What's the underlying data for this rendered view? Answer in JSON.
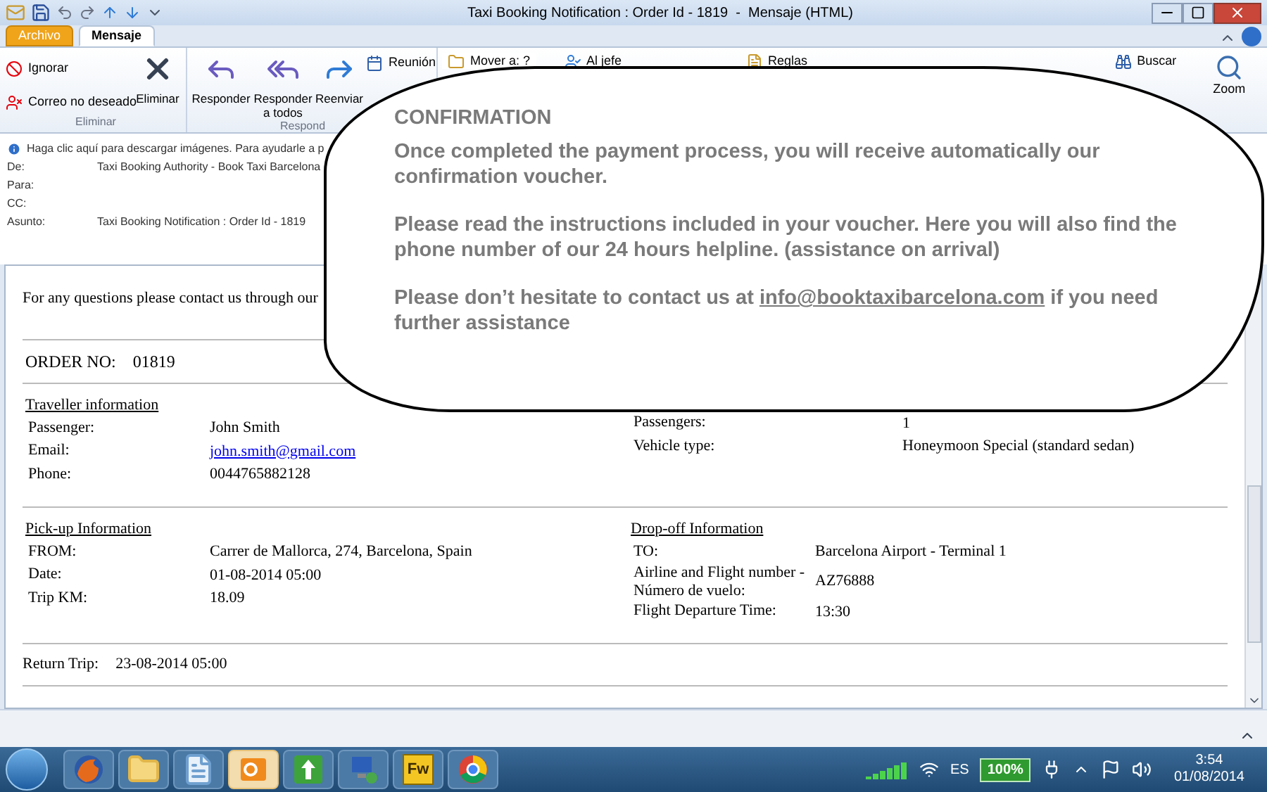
{
  "window": {
    "title": "Taxi Booking Notification : Order Id - 1819  -  Mensaje (HTML)"
  },
  "tabs": [
    {
      "label": "Archivo",
      "kind": "file",
      "selected": false
    },
    {
      "label": "Mensaje",
      "kind": "tab",
      "selected": true
    }
  ],
  "ribbon": {
    "groups": [
      {
        "label": "Eliminar",
        "small_buttons": [
          {
            "label": "Ignorar",
            "kind": "ignore"
          },
          {
            "label": "Correo no deseado",
            "kind": "junk"
          }
        ],
        "big_buttons": [
          {
            "label": "Eliminar",
            "kind": "delete"
          }
        ]
      },
      {
        "label": "Respond",
        "big_buttons": [
          {
            "label": "Responder",
            "kind": "reply"
          },
          {
            "label": "Responder a todos",
            "kind": "reply-all"
          },
          {
            "label": "Reenviar",
            "kind": "forward"
          }
        ]
      }
    ],
    "meeting_button": "Reunión",
    "move_button": "Mover a: ?",
    "boss_button": "Al jefe",
    "rules_button": "Reglas",
    "find_button": "Buscar",
    "zoom_button": "Zoom"
  },
  "info_bar": "Haga clic aquí para descargar imágenes. Para ayudarle a p",
  "header_fields": [
    {
      "label": "De:",
      "value": "Taxi Booking Authority - Book Taxi Barcelona"
    },
    {
      "label": "Para:"
    },
    {
      "label": "CC:"
    },
    {
      "label": "Asunto:",
      "value": "Taxi Booking Notification : Order Id - 1819"
    }
  ],
  "body": {
    "intro": "For any questions please contact us through our",
    "order_label": "ORDER NO:",
    "order_no": "01819",
    "sections": [
      {
        "title": "Traveller information",
        "left_rows": [
          {
            "label": "Passenger:",
            "value": "John Smith"
          },
          {
            "label": "Email:",
            "value": "john.smith@gmail.com",
            "kind": "link"
          },
          {
            "label": "Phone:",
            "value": "0044765882128"
          }
        ],
        "right_rows": [
          {
            "label": "Passengers:",
            "value": "1"
          },
          {
            "label": "Vehicle type:",
            "value": "Honeymoon Special (standard sedan)"
          }
        ]
      },
      {
        "title": "Pick-up Information",
        "right_title": "Drop-off Information",
        "left_rows": [
          {
            "label": "FROM:",
            "value": "Carrer de Mallorca, 274, Barcelona, Spain"
          },
          {
            "label": "Date:",
            "value": "01-08-2014 05:00"
          },
          {
            "label": "Trip KM:",
            "value": "18.09"
          }
        ],
        "right_rows": [
          {
            "label": "TO:",
            "value": "Barcelona Airport - Terminal 1"
          },
          {
            "label": "Airline and Flight number - Número de vuelo:",
            "value": "AZ76888"
          },
          {
            "label": "Flight Departure Time:",
            "value": "13:30"
          }
        ]
      }
    ],
    "return_label": "Return Trip:",
    "return_value": "23-08-2014 05:00"
  },
  "callout": {
    "title": "CONFIRMATION",
    "paragraphs": [
      {
        "text": "Once completed the payment process, you will receive automatically our confirmation voucher."
      },
      {
        "text": "Please read the instructions included in your voucher. Here you will also find the phone number of our 24 hours helpline. (assistance on arrival)"
      },
      {
        "text": "Please don’t hesitate to contact us at",
        "link": "info@booktaxibarcelona.com",
        "after": "if you need further assistance"
      }
    ]
  },
  "taskbar": {
    "apps": [
      {
        "kind": "fox",
        "selected": false
      },
      {
        "kind": "folder",
        "selected": false
      },
      {
        "kind": "notes",
        "selected": false
      },
      {
        "kind": "mail",
        "selected": true
      },
      {
        "kind": "update",
        "selected": false
      },
      {
        "kind": "network",
        "selected": false
      },
      {
        "kind": "fw",
        "label": "Fw",
        "selected": false
      },
      {
        "kind": "ring",
        "selected": false
      }
    ],
    "language": "ES",
    "battery": "100%",
    "time": "3:54",
    "date": "01/08/2014"
  }
}
